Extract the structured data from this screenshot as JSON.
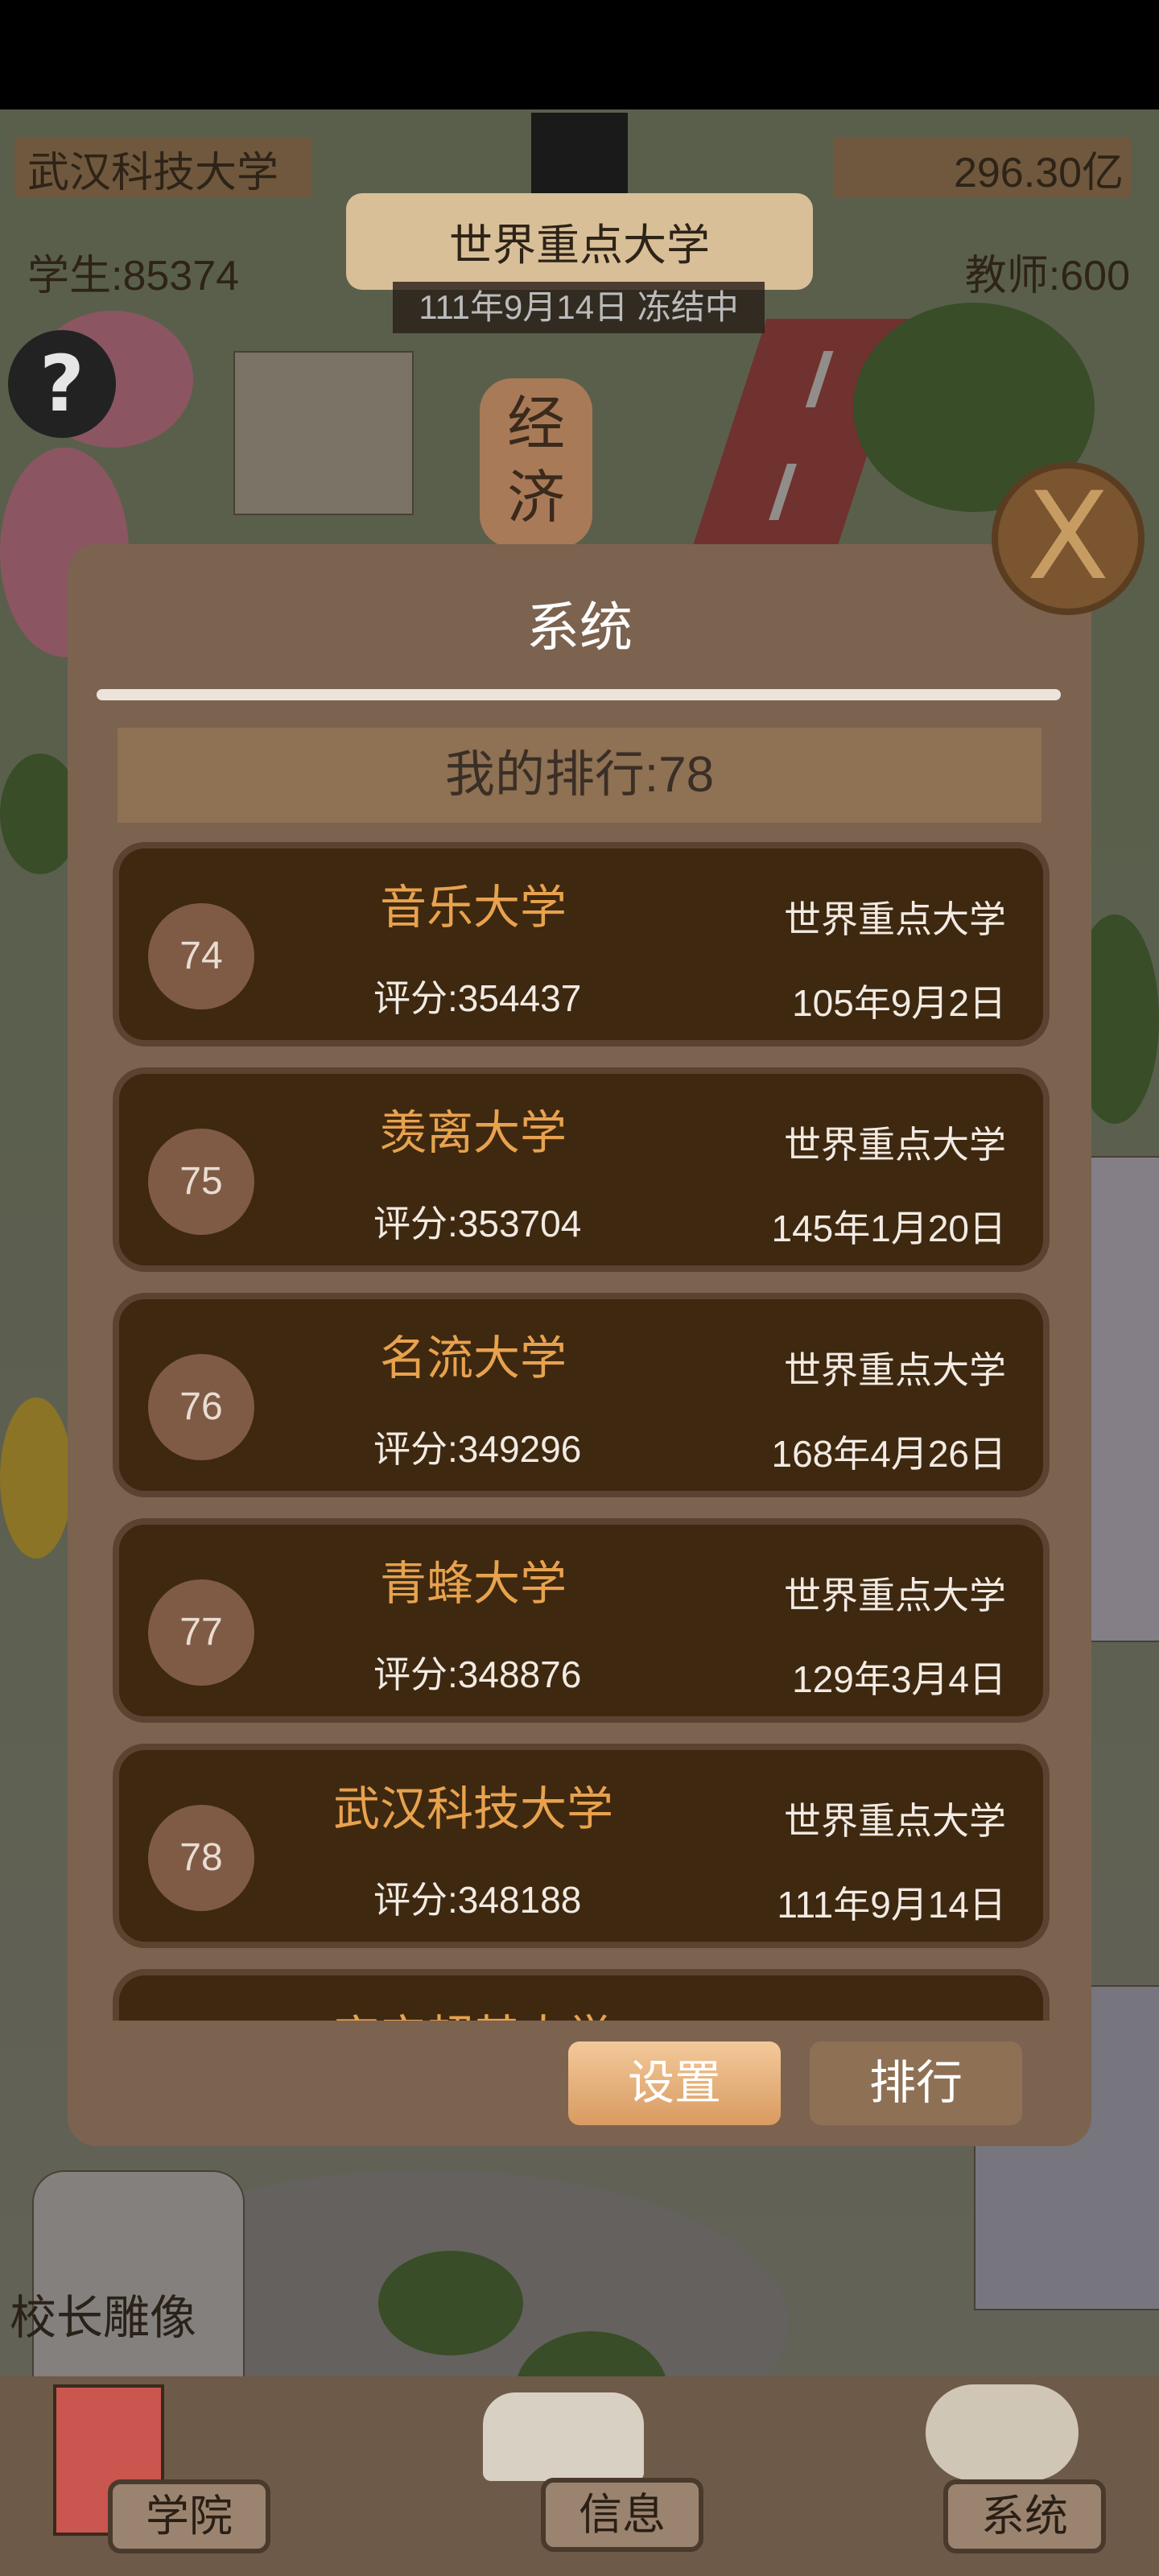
{
  "header": {
    "school_name": "武汉科技大学",
    "money": "296.30亿",
    "students": "学生:85374",
    "teachers": "教师:600",
    "rank_title": "世界重点大学",
    "date_status": "111年9月14日 冻结中"
  },
  "scene": {
    "sign_text": "经济",
    "statue_label": "校长雕像",
    "help_symbol": "?",
    "close_symbol": "X"
  },
  "panel": {
    "title": "系统",
    "my_rank": "我的排行:78",
    "rows": [
      {
        "rank": "74",
        "name": "音乐大学",
        "score": "评分:354437",
        "tier": "世界重点大学",
        "date": "105年9月2日"
      },
      {
        "rank": "75",
        "name": "羡离大学",
        "score": "评分:353704",
        "tier": "世界重点大学",
        "date": "145年1月20日"
      },
      {
        "rank": "76",
        "name": "名流大学",
        "score": "评分:349296",
        "tier": "世界重点大学",
        "date": "168年4月26日"
      },
      {
        "rank": "77",
        "name": "青蜂大学",
        "score": "评分:348876",
        "tier": "世界重点大学",
        "date": "129年3月4日"
      },
      {
        "rank": "78",
        "name": "武汉科技大学",
        "score": "评分:348188",
        "tier": "世界重点大学",
        "date": "111年9月14日"
      },
      {
        "rank": "",
        "name": "宇宙超基大学",
        "score": "",
        "tier": "",
        "date": ""
      }
    ],
    "buttons": {
      "settings": "设置",
      "ranking": "排行"
    }
  },
  "nav": {
    "college": "学院",
    "info": "信息",
    "system": "系统"
  },
  "colors": {
    "panel_bg": "#7b6350",
    "row_bg": "#3e2810",
    "name_orange": "#e8a24e",
    "badge_bg": "#7f5b46"
  }
}
